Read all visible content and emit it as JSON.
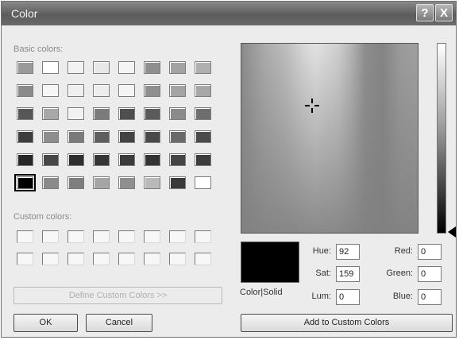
{
  "window": {
    "title": "Color",
    "help_icon_label": "?",
    "close_icon_label": "X"
  },
  "basic": {
    "label": "Basic colors:"
  },
  "basic_colors": [
    [
      "#9a9a9a",
      "#ffffff",
      "#f2f2f2",
      "#e7e7e7",
      "#f4f4f4",
      "#8f8f8f",
      "#a3a3a3",
      "#b0b0b0"
    ],
    [
      "#8a8a8a",
      "#f6f6f6",
      "#efefef",
      "#ededed",
      "#f4f4f4",
      "#8f8f8f",
      "#a4a4a4",
      "#a7a7a7"
    ],
    [
      "#575757",
      "#a8a8a8",
      "#f2f2f2",
      "#7b7b7b",
      "#4f4f4f",
      "#5b5b5b",
      "#8a8a8a",
      "#6e6e6e"
    ],
    [
      "#3d3d3d",
      "#8e8e8e",
      "#7a7a7a",
      "#5f5f5f",
      "#434343",
      "#4a4a4a",
      "#6a6a6a",
      "#4b4b4b"
    ],
    [
      "#262626",
      "#474747",
      "#2e2e2e",
      "#353535",
      "#3b3b3b",
      "#333333",
      "#454545",
      "#3c3c3c"
    ],
    [
      "#000000",
      "#8a8a8a",
      "#7e7e7e",
      "#a5a5a5",
      "#8f8f8f",
      "#b9b9b9",
      "#3a3a3a",
      "#ffffff"
    ]
  ],
  "custom": {
    "label": "Custom colors:"
  },
  "buttons": {
    "define_custom": "Define Custom Colors >>",
    "ok": "OK",
    "cancel": "Cancel",
    "add_custom": "Add to Custom Colors"
  },
  "preview": {
    "label": "Color|Solid",
    "color": "#000000"
  },
  "fields": {
    "hue": {
      "label": "Hue:",
      "value": "92"
    },
    "sat": {
      "label": "Sat:",
      "value": "159"
    },
    "lum": {
      "label": "Lum:",
      "value": "0"
    },
    "red": {
      "label": "Red:",
      "value": "0"
    },
    "green": {
      "label": "Green:",
      "value": "0"
    },
    "blue": {
      "label": "Blue:",
      "value": "0"
    }
  }
}
